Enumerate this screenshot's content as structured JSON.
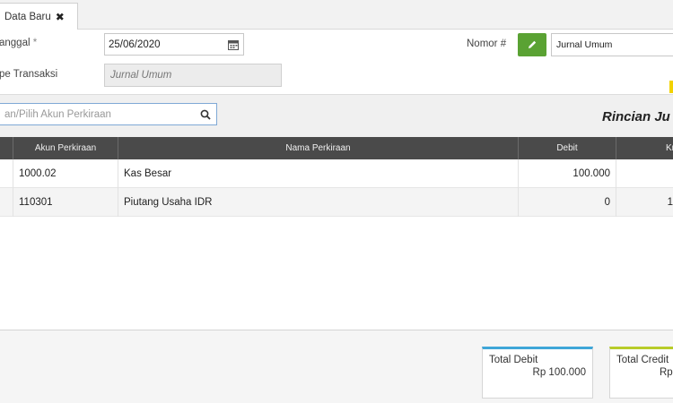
{
  "tab": {
    "label": "Data Baru",
    "close": "✖"
  },
  "form": {
    "tanggal_label": "anggal",
    "tanggal_required": "*",
    "tanggal_value": "25/06/2020",
    "tipe_label": "pe Transaksi",
    "tipe_value": "Jurnal Umum",
    "nomor_label": "Nomor #",
    "nomor_value": "Jurnal Umum"
  },
  "search": {
    "placeholder": "an/Pilih Akun Perkiraan"
  },
  "section_title": "Rincian Ju",
  "table": {
    "headers": {
      "akun": "Akun Perkiraan",
      "nama": "Nama Perkiraan",
      "debit": "Debit",
      "kredit": "Kredi"
    },
    "rows": [
      {
        "akun": "1000.02",
        "nama": "Kas Besar",
        "debit": "100.000",
        "kredit": ""
      },
      {
        "akun": "110301",
        "nama": "Piutang Usaha IDR",
        "debit": "0",
        "kredit": "1"
      }
    ]
  },
  "totals": {
    "debit_label": "Total Debit",
    "debit_value": "Rp 100.000",
    "credit_label": "Total Credit",
    "credit_value": "Rp"
  },
  "colors": {
    "accent_green": "#5aa233",
    "header_dark": "#4a4a4a",
    "debit_bar": "#3fa6d8",
    "credit_bar": "#b8cc2a"
  }
}
